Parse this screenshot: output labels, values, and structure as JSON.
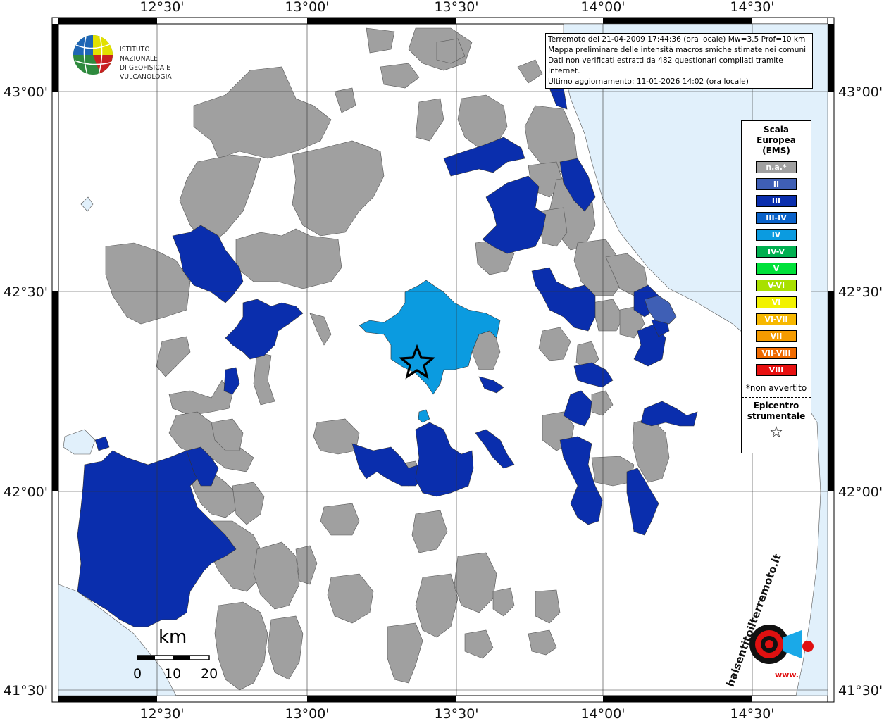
{
  "map": {
    "lon_labels": [
      "12°30'",
      "13°00'",
      "13°30'",
      "14°00'",
      "14°30'"
    ],
    "lat_labels": [
      "43°00'",
      "42°30'",
      "42°00'",
      "41°30'"
    ],
    "colors": {
      "land": "#ffffff",
      "sea": "#e1f0fb",
      "not_felt": "#a0a0a0",
      "int_II": "#3f5fb5",
      "int_III": "#0a2ead",
      "int_IV": "#0b9be0"
    }
  },
  "logo": {
    "line1": "ISTITUTO NAZIONALE",
    "line2": "DI GEOFISICA E VULCANOLOGIA"
  },
  "info": {
    "line1": "Terremoto del 21-04-2009 17:44:36 (ora locale) Mw=3.5 Prof=10 km",
    "line2": "Mappa preliminare delle intensità macrosismiche stimate nei comuni",
    "line3": "Dati non verificati estratti da 482 questionari compilati tramite Internet.",
    "line4": "Ultimo aggiornamento: 11-01-2026 14:02 (ora locale)"
  },
  "legend": {
    "title1": "Scala",
    "title2": "Europea",
    "title3": "(EMS)",
    "items": [
      {
        "label": "n.a.*",
        "color": "#a0a0a0"
      },
      {
        "label": "II",
        "color": "#3f5fb5"
      },
      {
        "label": "III",
        "color": "#0a2ead"
      },
      {
        "label": "III-IV",
        "color": "#0a62c9"
      },
      {
        "label": "IV",
        "color": "#0b9be0"
      },
      {
        "label": "IV-V",
        "color": "#00b050"
      },
      {
        "label": "V",
        "color": "#00e13a"
      },
      {
        "label": "V-VI",
        "color": "#a8e000"
      },
      {
        "label": "VI",
        "color": "#f2f200"
      },
      {
        "label": "VI-VII",
        "color": "#f7b800"
      },
      {
        "label": "VII",
        "color": "#f59b00"
      },
      {
        "label": "VII-VIII",
        "color": "#f06a00"
      },
      {
        "label": "VIII",
        "color": "#e81010"
      }
    ],
    "note": "*non avvertito",
    "epicenter1": "Epicentro",
    "epicenter2": "strumentale",
    "star": "☆"
  },
  "scale": {
    "unit": "km",
    "ticks": [
      "0",
      "10",
      "20"
    ]
  },
  "watermark": {
    "text": "haisentitoilterremoto.it",
    "url": "www."
  }
}
